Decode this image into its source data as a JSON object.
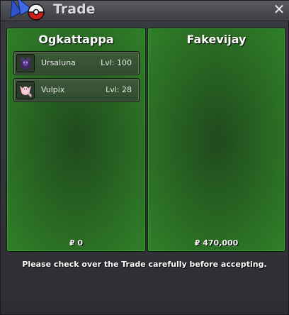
{
  "window": {
    "title": "Trade"
  },
  "left_player": {
    "name": "Ogkattappa",
    "money": "₽ 0",
    "items": [
      {
        "name": "Ursaluna",
        "level": "Lvl: 100",
        "icon": "ursaluna-sprite-icon"
      },
      {
        "name": "Vulpix",
        "level": "Lvl: 28",
        "icon": "vulpix-sprite-icon"
      }
    ]
  },
  "right_player": {
    "name": "Fakevijay",
    "money": "₽ 470,000",
    "items": []
  },
  "notice": "Please check over the Trade carefully before accepting.",
  "colors": {
    "panel_green": "#2a6a24",
    "window_bg": "#2d2d33"
  }
}
